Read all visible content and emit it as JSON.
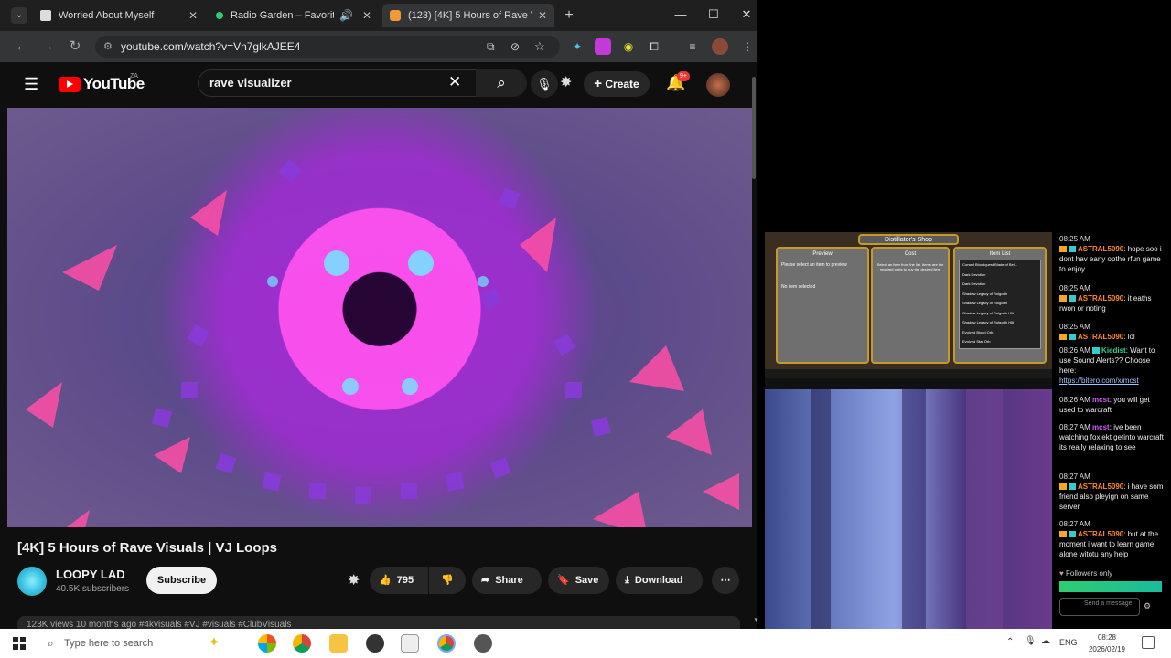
{
  "browser": {
    "tabs": [
      {
        "title": "Worried About Myself",
        "active": false
      },
      {
        "title": "Radio Garden – Favorites",
        "active": false
      },
      {
        "title": "(123) [4K] 5 Hours of Rave Visu",
        "active": true
      }
    ],
    "url": "youtube.com/watch?v=Vn7glkAJEE4"
  },
  "youtube": {
    "logo_text": "YouTube",
    "region": "ZA",
    "search_value": "rave visualizer",
    "create_label": "Create",
    "notifications_count": "9+",
    "video": {
      "title": "[4K] 5 Hours of Rave Visuals | VJ Loops",
      "channel": "LOOPY LAD",
      "subscribers": "40.5K subscribers",
      "subscribe_label": "Subscribe",
      "likes": "795",
      "share_label": "Share",
      "save_label": "Save",
      "download_label": "Download",
      "meta_line": "123K views  10 months ago  #4kvisuals #VJ #visuals #ClubVisuals"
    }
  },
  "game": {
    "shop_title": "Distillator's Shop",
    "preview_label": "Preview",
    "cost_label": "Cost",
    "item_list_label": "Item List",
    "preview_hint": "Please select an item to preview",
    "no_item": "No item selected",
    "cost_hint": "Select an item from the list. Items are the required parts to buy the desired item",
    "items": [
      "Cursed Bloodquest Blade of Bel...",
      "Dark Devotion",
      "Dark Devotion",
      "Shadow Legacy of Rolgorth",
      "Shadow Legacy of Rolgorth",
      "Shadow Legacy of Rolgorth Hilt",
      "Shadow Legacy of Rolgorth Hilt",
      "Evolved Blood Orb",
      "Evolved Star Orb"
    ]
  },
  "chat": {
    "messages": [
      {
        "time": "08:25 AM",
        "user": "ASTRAL5090",
        "text": "hope soo i dont hav eany opthe rfun game to enjoy"
      },
      {
        "time": "08:25 AM",
        "user": "ASTRAL5090",
        "text": "it eaths rwon or noting"
      },
      {
        "time": "08:25 AM",
        "user": "ASTRAL5090",
        "text": "lol"
      },
      {
        "time": "08:26 AM",
        "user": "Kiedist",
        "text": "Want to use Sound Alerts?? Choose here:",
        "link": "https://bitero.com/x/mcst"
      },
      {
        "time": "08:26 AM",
        "user": "mcst",
        "text": "you will get used to warcraft"
      },
      {
        "time": "08:27 AM",
        "user": "mcst",
        "text": "ive been watching foxiekt getinto warcraft its really relaxing to see"
      },
      {
        "time": "08:27 AM",
        "user": "ASTRAL5090",
        "text": "i have som friend also pleyign on same server"
      },
      {
        "time": "08:27 AM",
        "user": "ASTRAL5090",
        "text": "but at the moment i want to learn game alone witotu any help"
      }
    ],
    "followers_only": "Followers only",
    "send_placeholder": "Send a message"
  },
  "taskbar": {
    "search_placeholder": "Type here to search",
    "language": "ENG",
    "time": "08:28",
    "date": "2026/02/19"
  }
}
